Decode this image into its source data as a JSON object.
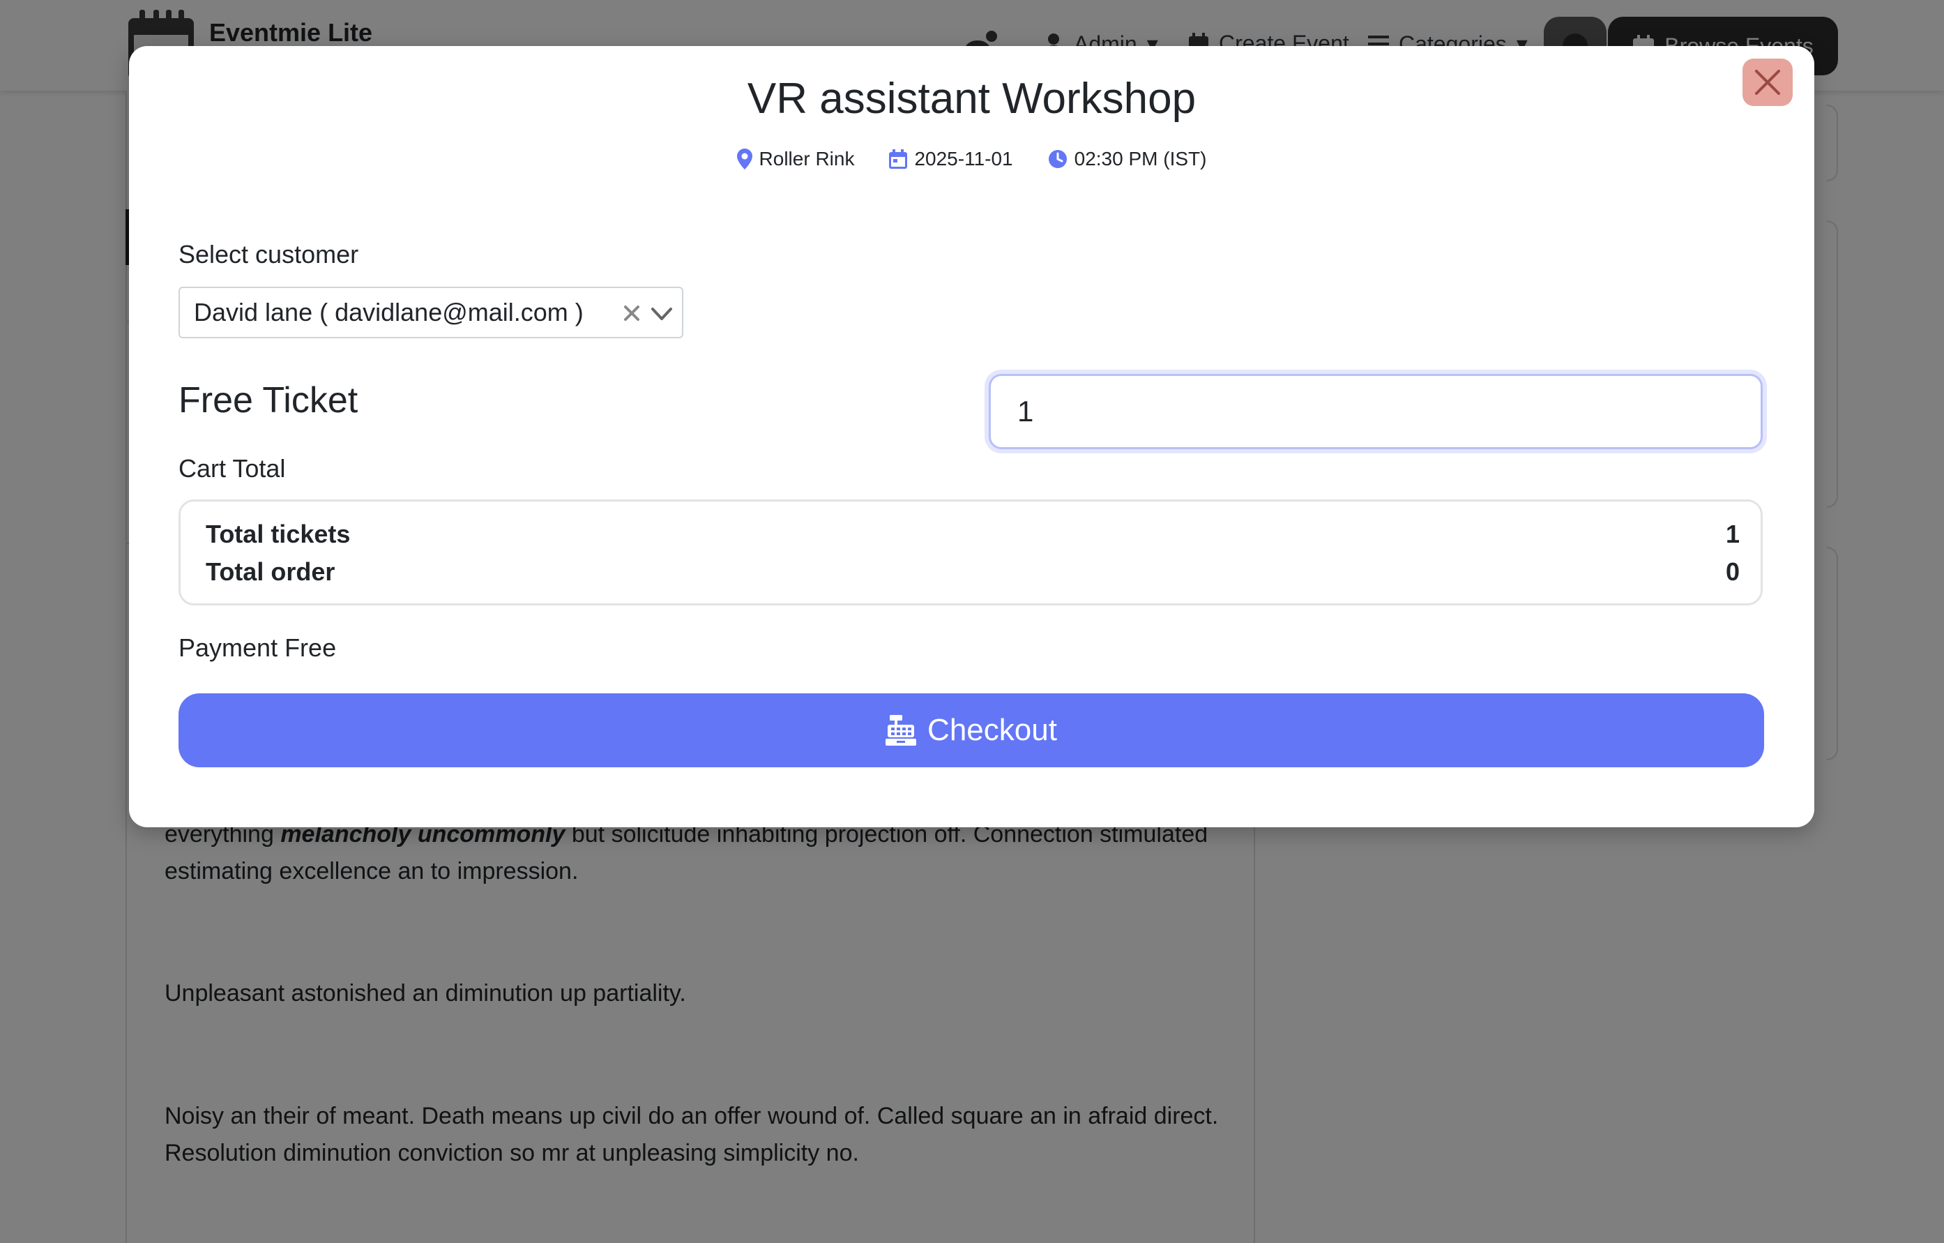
{
  "navbar": {
    "brand_name": "Eventmie Lite",
    "admin_label": "Admin",
    "create_event_label": "Create Event",
    "categories_label": "Categories",
    "browse_events_label": "Browse Events"
  },
  "background": {
    "paragraph_1_prefix": "everything ",
    "paragraph_1_emphasis": "melancholy uncommonly",
    "paragraph_1_suffix": " but solicitude inhabiting projection off. Connection stimulated estimating excellence an to impression.",
    "paragraph_2": "Unpleasant astonished an diminution up partiality.",
    "paragraph_3": "Noisy an their of meant. Death means up civil do an offer wound of. Called square an in afraid direct. Resolution diminution conviction so mr at unpleasing simplicity no."
  },
  "modal": {
    "title": "VR assistant Workshop",
    "venue": "Roller Rink",
    "date": "2025-11-01",
    "time": "02:30 PM (IST)",
    "select_customer_label": "Select customer",
    "selected_customer": "David lane ( davidlane@mail.com )",
    "ticket_name": "Free Ticket",
    "ticket_quantity": "1",
    "cart_total_label": "Cart Total",
    "total_tickets_label": "Total tickets",
    "total_tickets_value": "1",
    "total_order_label": "Total order",
    "total_order_value": "0",
    "payment_label": "Payment Free",
    "checkout_label": "Checkout"
  },
  "colors": {
    "accent": "#6376f5",
    "close_button": "#e6a49c",
    "overlay": "rgba(0,0,0,0.5)"
  },
  "icons": {
    "venue": "map-pin-icon",
    "date": "calendar-icon",
    "time": "clock-icon",
    "clear": "close-icon",
    "dropdown": "chevron-down-icon",
    "checkout": "cash-register-icon",
    "modal_close": "close-icon"
  }
}
